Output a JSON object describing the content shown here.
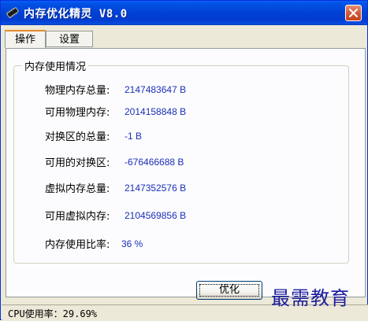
{
  "window": {
    "title": "内存优化精灵 V8.0",
    "close_icon": "close-icon"
  },
  "tabs": [
    {
      "label": "操作",
      "active": true
    },
    {
      "label": "设置",
      "active": false
    }
  ],
  "memory_group": {
    "title": "内存使用情况",
    "rows": [
      {
        "label": "物理内存总量:",
        "value": "2147483647 B"
      },
      {
        "label": "可用物理内存:",
        "value": "2014158848 B"
      },
      {
        "label": "对换区的总量:",
        "value": "-1 B"
      },
      {
        "label": "可用的对换区:",
        "value": "-676466688 B"
      },
      {
        "label": "虚拟内存总量:",
        "value": "2147352576 B"
      },
      {
        "label": "可用虚拟内存:",
        "value": "2104569856 B"
      },
      {
        "label": "内存使用比率:",
        "value": "36 %"
      }
    ]
  },
  "actions": {
    "optimize_label": "优化"
  },
  "status": {
    "cpu_text": "CPU使用率：29.69%"
  },
  "watermark": {
    "text": "最需教育"
  },
  "colors": {
    "title_bar": "#0041d4",
    "value_text": "#1a2fb8",
    "close_button": "#d15a38"
  }
}
